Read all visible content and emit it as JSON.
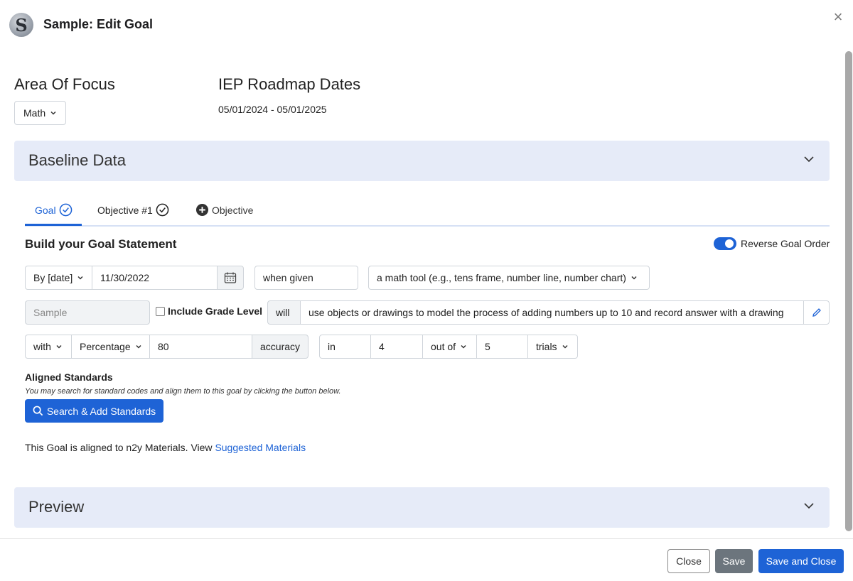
{
  "header": {
    "title": "Sample: Edit Goal",
    "avatar_letter": "S"
  },
  "area_of_focus": {
    "heading": "Area Of Focus",
    "selected": "Math"
  },
  "iep": {
    "heading": "IEP Roadmap Dates",
    "dates": "05/01/2024 - 05/01/2025"
  },
  "baseline": {
    "title": "Baseline Data"
  },
  "tabs": {
    "goal": "Goal",
    "objective1": "Objective #1",
    "add_objective": "Objective"
  },
  "build": {
    "title": "Build your Goal Statement",
    "reverse_label": "Reverse Goal Order",
    "reverse_on": true
  },
  "row1": {
    "by_select": "By [date]",
    "date": "11/30/2022",
    "when_given": "when given",
    "tool_select": "a math tool (e.g., tens frame, number line, number chart)"
  },
  "row2": {
    "name_placeholder": "Sample",
    "include_grade": "Include Grade Level",
    "will": "will",
    "statement": "use objects or drawings to model the process of adding numbers up to 10 and record answer with a drawing"
  },
  "row3": {
    "with_select": "with",
    "measure_select": "Percentage",
    "value": "80",
    "accuracy": "accuracy",
    "in": "in",
    "count": "4",
    "out_of_select": "out of",
    "total": "5",
    "trials_select": "trials"
  },
  "standards": {
    "title": "Aligned Standards",
    "subtitle": "You may search for standard codes and align them to this goal by clicking the button below.",
    "button": "Search & Add Standards"
  },
  "aligned": {
    "text": "This Goal is aligned to n2y Materials. View",
    "link": "Suggested Materials"
  },
  "preview": {
    "title": "Preview"
  },
  "footer": {
    "close": "Close",
    "save": "Save",
    "save_close": "Save and Close"
  },
  "colors": {
    "accent": "#1e63d6",
    "panel_bg": "#e6ebf8",
    "save_gray": "#6c757d"
  }
}
